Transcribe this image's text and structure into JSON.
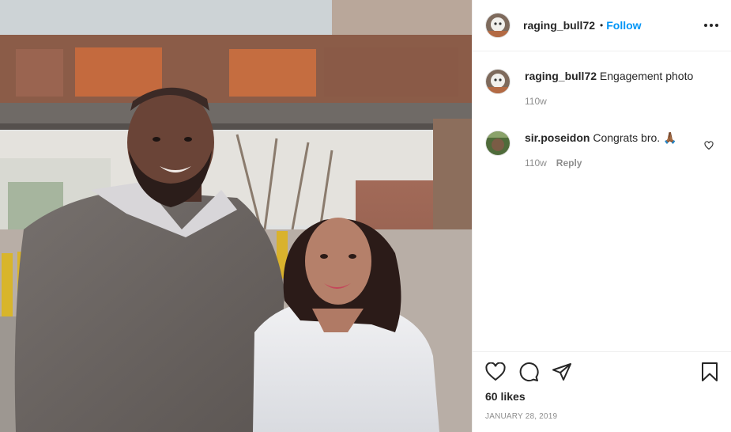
{
  "post": {
    "author": "raging_bull72",
    "follow_label": "Follow",
    "separator": "•"
  },
  "comments": [
    {
      "username": "raging_bull72",
      "text": "Engagement photo",
      "age": "110w",
      "reply_label": ""
    },
    {
      "username": "sir.poseidon",
      "text": "Congrats bro. 🙏🏾",
      "age": "110w",
      "reply_label": "Reply"
    }
  ],
  "footer": {
    "likes": "60 likes",
    "date": "JANUARY 28, 2019"
  },
  "icons": {
    "like": "heart-icon",
    "comment": "comment-icon",
    "share": "paper-plane-icon",
    "save": "bookmark-icon",
    "more": "more-options-icon"
  }
}
